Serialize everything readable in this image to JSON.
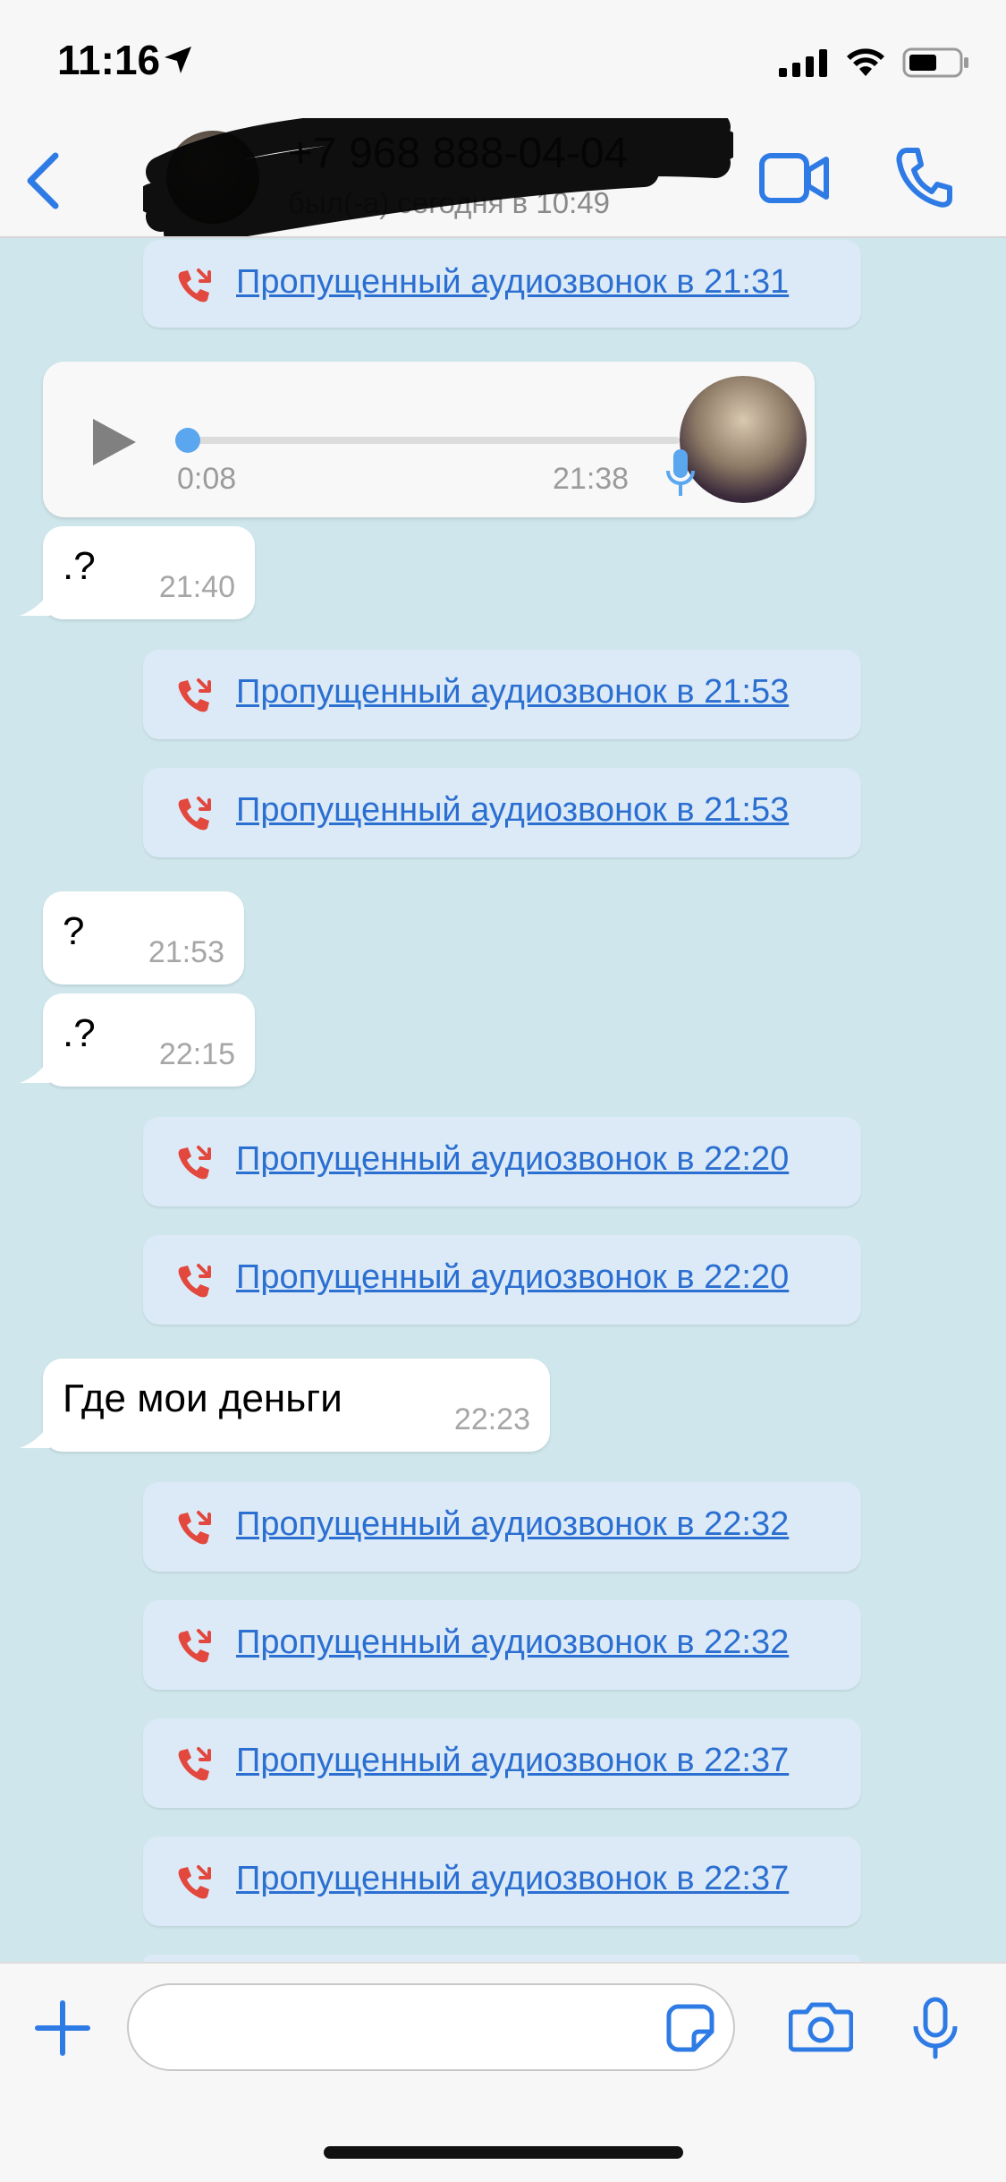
{
  "status_bar": {
    "time": "11:16"
  },
  "header": {
    "contact_name": "+7 968 888-04-04",
    "contact_status": "был(-а) сегодня в 10:49"
  },
  "messages": {
    "call_0": "Пропущенный аудиозвонок в 21:31",
    "voice": {
      "duration": "0:08",
      "time": "21:38"
    },
    "msg_1": {
      "text": ".?",
      "time": "21:40"
    },
    "call_1": "Пропущенный аудиозвонок в 21:53",
    "call_2": "Пропущенный аудиозвонок в 21:53",
    "msg_2": {
      "text": "?",
      "time": "21:53"
    },
    "msg_3": {
      "text": ".?",
      "time": "22:15"
    },
    "call_3": "Пропущенный аудиозвонок в 22:20",
    "call_4": "Пропущенный аудиозвонок в 22:20",
    "msg_4": {
      "text": "Где мои деньги",
      "time": "22:23"
    },
    "call_5": "Пропущенный аудиозвонок в 22:32",
    "call_6": "Пропущенный аудиозвонок в 22:32",
    "call_7": "Пропущенный аудиозвонок в 22:37",
    "call_8": "Пропущенный аудиозвонок в 22:37"
  },
  "input": {
    "value": ""
  },
  "icons": {
    "back": "chevron-left-icon",
    "video": "video-camera-icon",
    "phone": "phone-icon",
    "missed_call": "missed-call-icon",
    "play": "play-icon",
    "mic": "microphone-icon",
    "plus": "plus-icon",
    "sticker": "sticker-icon",
    "camera": "camera-icon"
  },
  "colors": {
    "accent": "#2f7be5",
    "chat_background": "#cfe7ec",
    "call_bubble": "#dceaf7",
    "missed_call_red": "#e2483d"
  }
}
